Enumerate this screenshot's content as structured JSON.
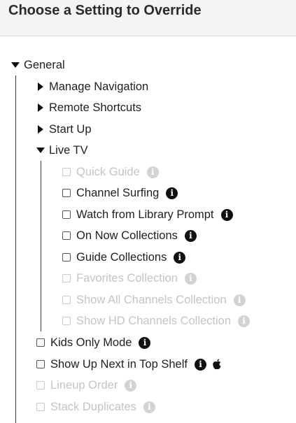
{
  "header": {
    "title": "Choose a Setting to Override"
  },
  "icons": {
    "expanded": "caret-down-icon",
    "collapsed": "caret-right-icon",
    "info": "info-circle-icon",
    "platform": "apple-icon"
  },
  "tree": {
    "general": {
      "label": "General",
      "expanded": true,
      "children": {
        "manage_navigation": {
          "label": "Manage Navigation",
          "expanded": false
        },
        "remote_shortcuts": {
          "label": "Remote Shortcuts",
          "expanded": false
        },
        "start_up": {
          "label": "Start Up",
          "expanded": false
        },
        "live_tv": {
          "label": "Live TV",
          "expanded": true,
          "items": [
            {
              "label": "Quick Guide",
              "checked": false,
              "enabled": false
            },
            {
              "label": "Channel Surfing",
              "checked": false,
              "enabled": true
            },
            {
              "label": "Watch from Library Prompt",
              "checked": false,
              "enabled": true
            },
            {
              "label": "On Now Collections",
              "checked": false,
              "enabled": true
            },
            {
              "label": "Guide Collections",
              "checked": false,
              "enabled": true
            },
            {
              "label": "Favorites Collection",
              "checked": false,
              "enabled": false
            },
            {
              "label": "Show All Channels Collection",
              "checked": false,
              "enabled": false
            },
            {
              "label": "Show HD Channels Collection",
              "checked": false,
              "enabled": false
            }
          ]
        },
        "options": [
          {
            "label": "Kids Only Mode",
            "checked": false,
            "enabled": true
          },
          {
            "label": "Show Up Next in Top Shelf",
            "checked": false,
            "enabled": true,
            "platform": "apple"
          },
          {
            "label": "Lineup Order",
            "checked": false,
            "enabled": false
          },
          {
            "label": "Stack Duplicates",
            "checked": false,
            "enabled": false
          }
        ]
      }
    }
  }
}
